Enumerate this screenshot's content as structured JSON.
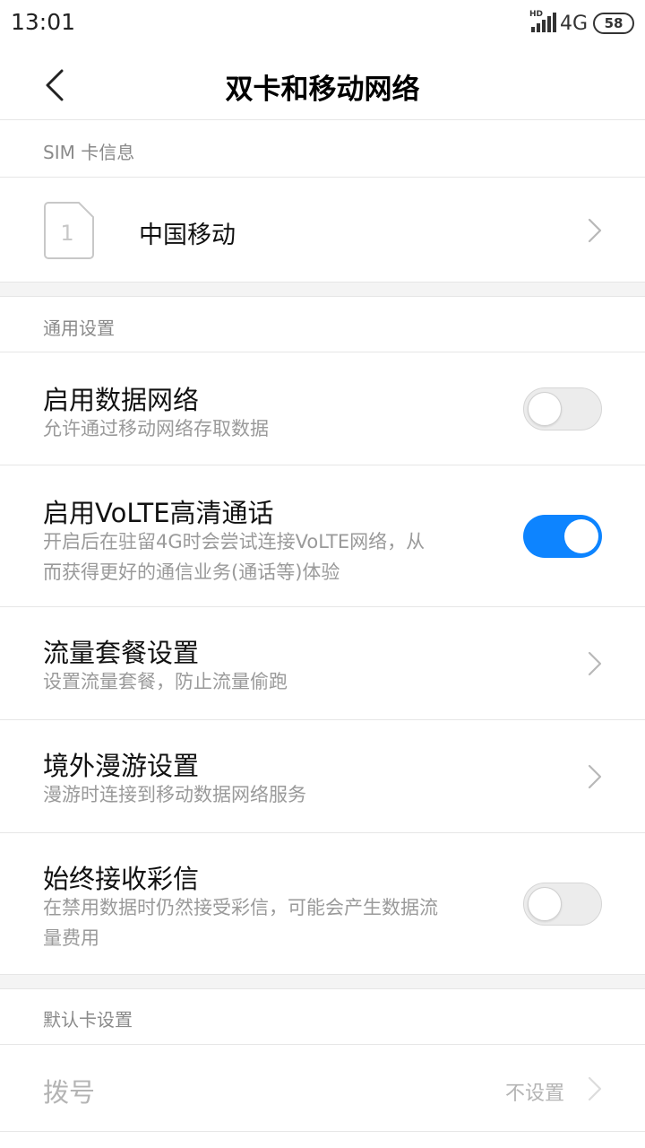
{
  "status_bar": {
    "time": "13:01",
    "hd_label": "HD",
    "network": "4G",
    "battery": "58"
  },
  "header": {
    "title": "双卡和移动网络",
    "back_icon": "chevron-left-icon"
  },
  "sim_section": {
    "header": "SIM 卡信息",
    "card": {
      "slot": "1",
      "carrier": "中国移动"
    }
  },
  "general_section": {
    "header": "通用设置",
    "items": [
      {
        "title": "启用数据网络",
        "desc": "允许通过移动网络存取数据",
        "control": "toggle",
        "enabled": false
      },
      {
        "title": "启用VoLTE高清通话",
        "desc_line1": "开启后在驻留4G时会尝试连接VoLTE网络，从",
        "desc_line2": "而获得更好的通信业务(通话等)体验",
        "control": "toggle",
        "enabled": true
      },
      {
        "title": "流量套餐设置",
        "desc": "设置流量套餐，防止流量偷跑",
        "control": "chevron"
      },
      {
        "title": "境外漫游设置",
        "desc": "漫游时连接到移动数据网络服务",
        "control": "chevron"
      },
      {
        "title": "始终接收彩信",
        "desc_line1": "在禁用数据时仍然接受彩信，可能会产生数据流",
        "desc_line2": "量费用",
        "control": "toggle",
        "enabled": false
      }
    ]
  },
  "default_section": {
    "header": "默认卡设置",
    "dial": {
      "title": "拨号",
      "value": "不设置"
    }
  },
  "colors": {
    "accent": "#0d84ff",
    "secondary_text": "#9a9a9a",
    "divider": "#e6e6e6",
    "gap_bg": "#f4f4f4"
  }
}
